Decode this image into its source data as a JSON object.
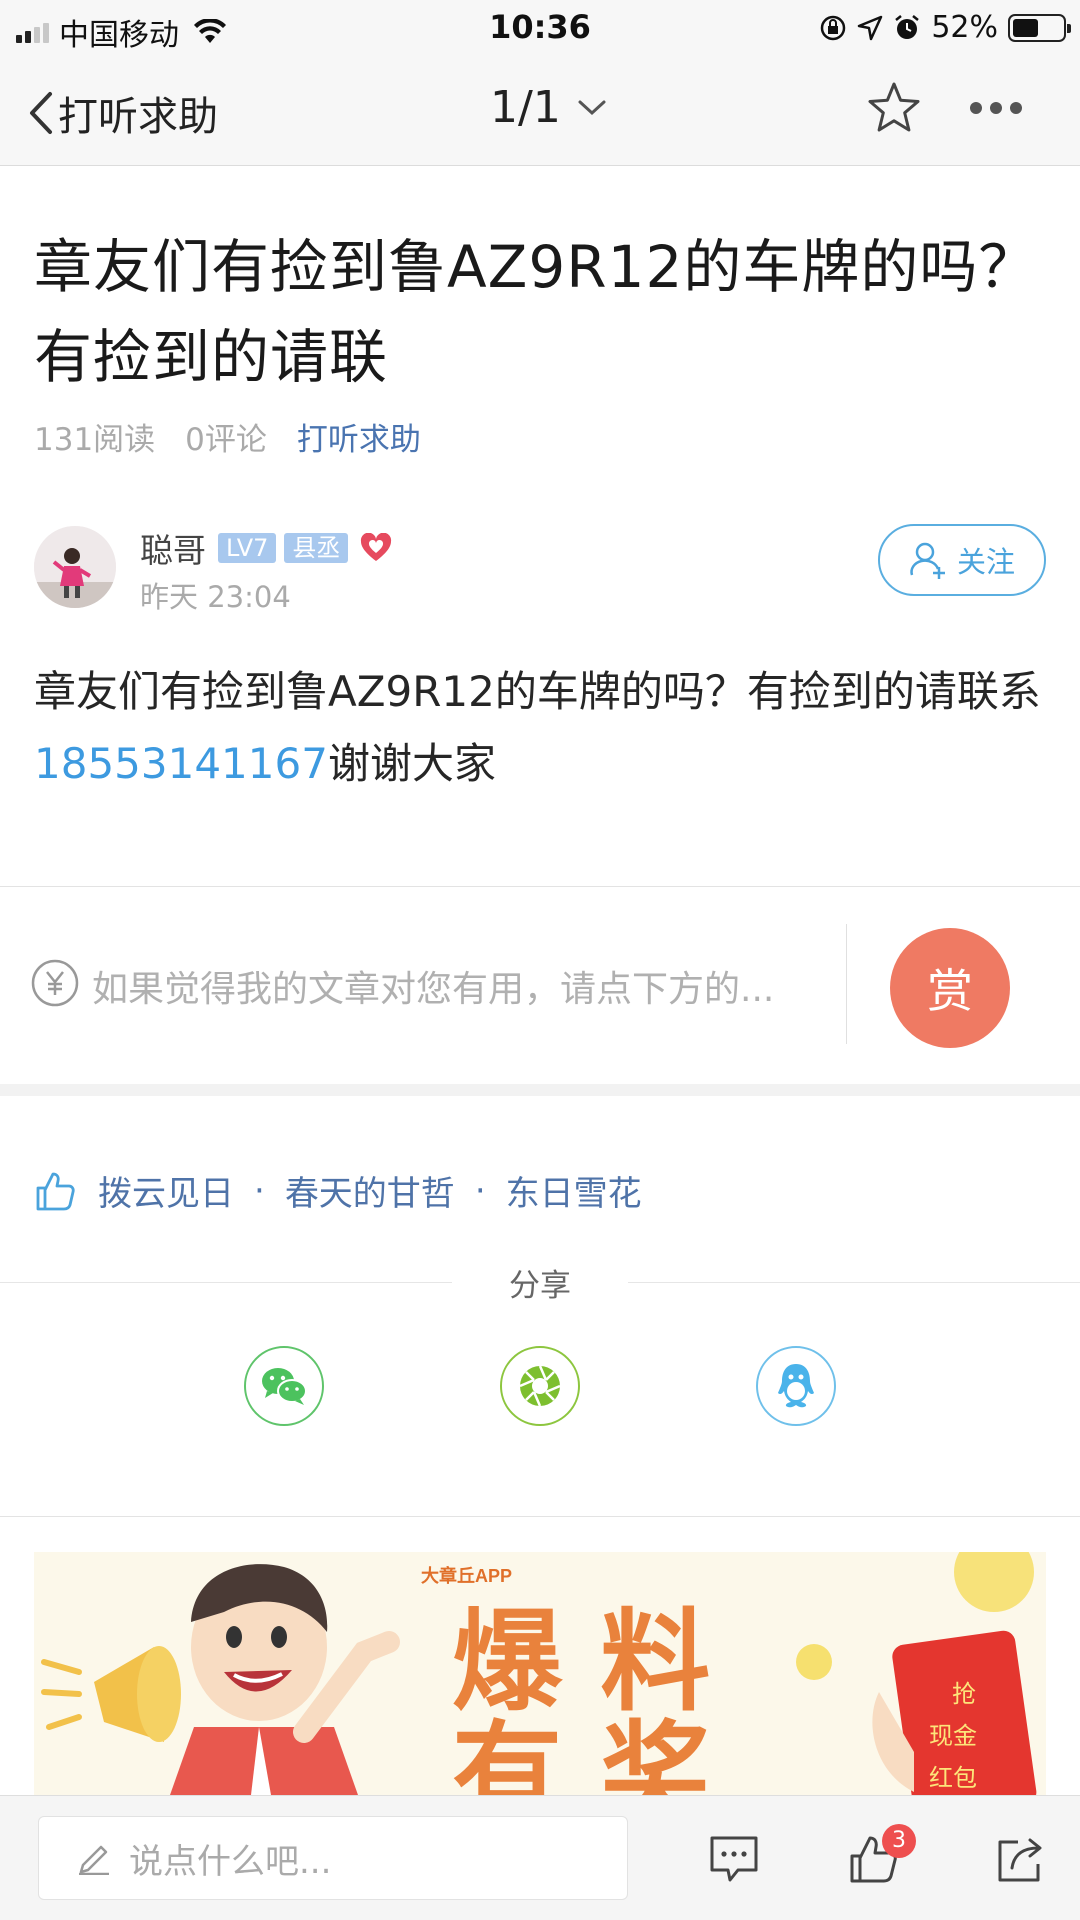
{
  "status_bar": {
    "carrier": "中国移动",
    "time": "10:36",
    "battery": "52%",
    "battery_level": 0.52,
    "signal_bars": 2
  },
  "nav": {
    "back_label": "打听求助",
    "page_indicator": "1/1"
  },
  "article": {
    "title": "章友们有捡到鲁AZ9R12的车牌的吗？有捡到的请联",
    "reads": "131阅读",
    "comments": "0评论",
    "category": "打听求助",
    "body_before": "章友们有捡到鲁AZ9R12的车牌的吗？有捡到的请联系",
    "body_phone": "18553141167",
    "body_after": "谢谢大家"
  },
  "author": {
    "name": "聪哥",
    "level_badge": "LV7",
    "title_badge": "县丞",
    "time": "昨天 23:04",
    "follow_label": "关注"
  },
  "reward": {
    "prompt": "如果觉得我的文章对您有用，请点下方的...",
    "button_label": "赏"
  },
  "likes": {
    "users": [
      "拨云见日",
      "春天的甘哲",
      "东日雪花"
    ],
    "separator": "·"
  },
  "share": {
    "label": "分享",
    "targets": [
      "wechat-icon",
      "moments-icon",
      "qq-icon"
    ]
  },
  "banner": {
    "app_name": "大章丘APP",
    "headline_line1": "爆 料",
    "headline_line2": "有 奖",
    "envelope_text": [
      "抢",
      "现金",
      "红包"
    ]
  },
  "bottom_bar": {
    "comment_placeholder": "说点什么吧...",
    "like_count": "3"
  },
  "colors": {
    "link_blue": "#3d9ae0",
    "category_blue": "#4a74b0",
    "reward_orange": "#ef7a63",
    "badge_red": "#ee4f4f"
  }
}
